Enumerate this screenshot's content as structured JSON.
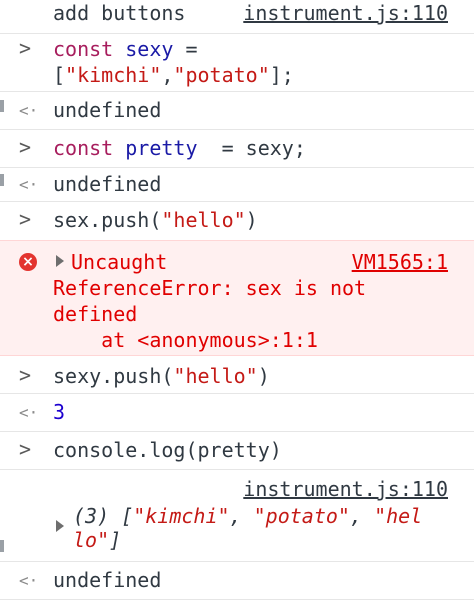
{
  "rows": {
    "log_add": {
      "text": "add buttons",
      "source": "instrument.js:110"
    },
    "input1": {
      "prompt": ">",
      "kw": "const",
      "name": "sexy",
      "eq": " =",
      "line2_open": "[",
      "str1": "\"kimchi\"",
      "comma": ",",
      "str2": "\"potato\"",
      "line2_close": "];"
    },
    "result1": {
      "marker": "<·",
      "text": "undefined"
    },
    "input2": {
      "prompt": ">",
      "kw": "const",
      "name": "pretty",
      "rest": "  = sexy;"
    },
    "result2": {
      "marker": "<·",
      "text": "undefined"
    },
    "input3": {
      "prompt": ">",
      "code_start": "sex.push(",
      "str": "\"hello\"",
      "code_end": ")"
    },
    "error": {
      "icon": "×",
      "label": "Uncaught",
      "source": "VM1565:1",
      "line1": "ReferenceError: sex is not",
      "line2": "defined",
      "line3": "    at <anonymous>:1:1"
    },
    "input4": {
      "prompt": ">",
      "code_start": "sexy.push(",
      "str": "\"hello\"",
      "code_end": ")"
    },
    "result4": {
      "marker": "<·",
      "value": "3"
    },
    "input5": {
      "prompt": ">",
      "code": "console.log(pretty)"
    },
    "log_array": {
      "source": "instrument.js:110",
      "count": "(3) [",
      "s1": "\"kimchi\"",
      "sep1": ", ",
      "s2": "\"potato\"",
      "sep2": ", ",
      "s3a": "\"hel",
      "s3b": "lo\"",
      "close": "]"
    },
    "result5": {
      "marker": "<·",
      "text": "undefined"
    }
  },
  "colors": {
    "keyword": "#a71d5d",
    "variable": "#1a1aa6",
    "string": "#c41a16",
    "number": "#1c00cf",
    "error_text": "#e00000",
    "error_bg": "#fff0f0"
  }
}
